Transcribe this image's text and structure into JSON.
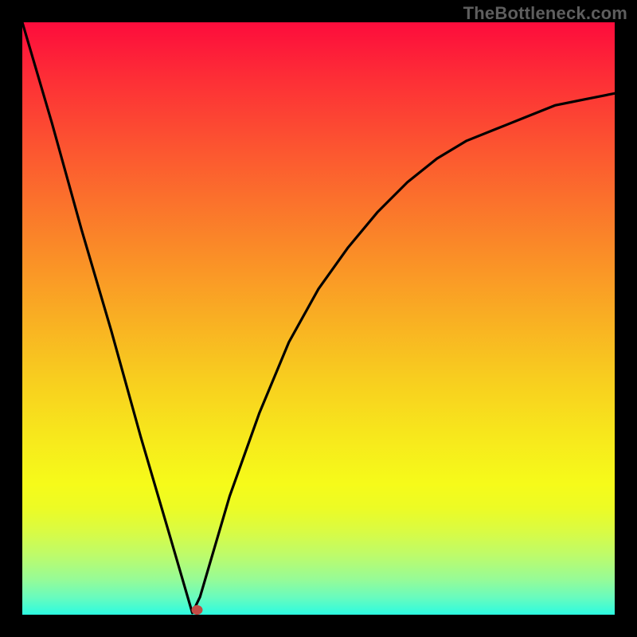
{
  "watermark": "TheBottleneck.com",
  "chart_data": {
    "type": "line",
    "title": "",
    "xlabel": "",
    "ylabel": "",
    "xlim": [
      0,
      1
    ],
    "ylim": [
      0,
      1
    ],
    "grid": false,
    "legend": false,
    "series": [
      {
        "name": "curve",
        "x": [
          0.0,
          0.05,
          0.1,
          0.15,
          0.2,
          0.25,
          0.287,
          0.3,
          0.35,
          0.4,
          0.45,
          0.5,
          0.55,
          0.6,
          0.65,
          0.7,
          0.75,
          0.8,
          0.85,
          0.9,
          0.95,
          1.0
        ],
        "values": [
          1.0,
          0.83,
          0.65,
          0.48,
          0.3,
          0.13,
          0.003,
          0.03,
          0.2,
          0.34,
          0.46,
          0.55,
          0.62,
          0.68,
          0.73,
          0.77,
          0.8,
          0.82,
          0.84,
          0.86,
          0.87,
          0.88
        ]
      }
    ],
    "marker": {
      "name": "minimum-marker",
      "x": 0.295,
      "y": 0.008,
      "color": "#c24a44",
      "radius_px": 7
    },
    "background_gradient": {
      "stops": [
        {
          "pos": 0.0,
          "color": "#fd0c3c"
        },
        {
          "pos": 0.1,
          "color": "#fd3036"
        },
        {
          "pos": 0.2,
          "color": "#fc5131"
        },
        {
          "pos": 0.3,
          "color": "#fb712c"
        },
        {
          "pos": 0.4,
          "color": "#fa9027"
        },
        {
          "pos": 0.5,
          "color": "#f9af23"
        },
        {
          "pos": 0.6,
          "color": "#f8cd1f"
        },
        {
          "pos": 0.7,
          "color": "#f7e81c"
        },
        {
          "pos": 0.78,
          "color": "#f6fb1a"
        },
        {
          "pos": 0.82,
          "color": "#ecfb25"
        },
        {
          "pos": 0.86,
          "color": "#d9fb44"
        },
        {
          "pos": 0.9,
          "color": "#bdfb6b"
        },
        {
          "pos": 0.94,
          "color": "#97fb96"
        },
        {
          "pos": 0.97,
          "color": "#6afbbd"
        },
        {
          "pos": 1.0,
          "color": "#2cfbe1"
        }
      ]
    }
  }
}
